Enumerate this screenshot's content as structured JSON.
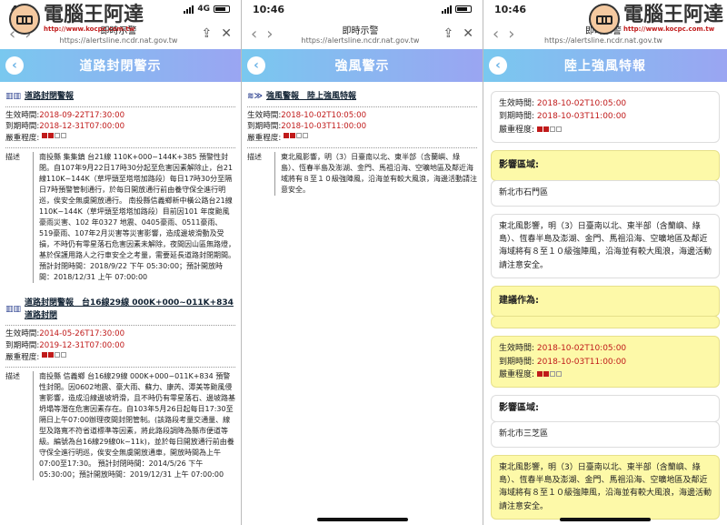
{
  "p1": {
    "time": "46",
    "net": "4G",
    "url_title": "即時示警",
    "url": "https://alertsline.ncdr.nat.gov.tw",
    "header": "道路封閉警示",
    "alerts": [
      {
        "head": "道路封閉警報",
        "effective_label": "生效時間:",
        "effective": "2018-09-22T17:30:00",
        "expire_label": "到期時間:",
        "expire": "2018-12-31T07:00:00",
        "sev_label": "嚴重程度:",
        "desc_label": "描述",
        "desc": "南投縣 集集鎮 台21線 110K+000~144K+385 預警性封閉。自107年9月22日17時30分起至危害因素解除止，台21線110K~144K（草坪頭至塔塔加路段）每日17時30分至隔日7時預警管制通行，於每日開放通行前由養守保全進行明巡，俟安全無虞開放通行。 南投縣信義鄉新中橫公路台21線 110K~144K（草坪頭至塔塔加路段）目前因101 年度颱風豪雨災害、102 年0327 地震、0405豪雨、0511豪雨、519豪雨、107年2月災害等災害影響，造成邊坡滑動及受損，不時仍有零星落石危害因素未解除，夜間因山區無路燈，基於保護用路人之行車安全之考量，需要延長道路封閉期間。 預計封閉時間：2018/9/22 下午 05:30:00；預計開放時間：2018/12/31 上午 07:00:00"
      },
      {
        "head": "道路封閉警報　台16線29線 000K+000~011K+834 道路封閉",
        "effective_label": "生效時間:",
        "effective": "2014-05-26T17:30:00",
        "expire_label": "到期時間:",
        "expire": "2019-12-31T07:00:00",
        "sev_label": "嚴重程度:",
        "desc_label": "描述",
        "desc": "南投縣 信義鄉 台16線29線 000K+000~011K+834 預警性封閉。因0602地震、豪大雨、蘇力、康芮、潭美等颱風侵害影響，造成沿線邊坡坍滑，且不時仍有零星落石、邊坡路基坍塌等潛在危害因素存在。自103年5月26日起每日17:30至隔日上午07:00辦理夜間封閉管制。(該路段考量交通量、線型及路寬不符省道標準等因素，將此路段調降為縣市便道等級。編號為台16線29線0k~11k)，並於每日開放通行前由養守保全進行明巡，俟安全無虞開放通車，開放時間為上午07:00至17:30。 預計封閉時間：2014/5/26 下午 05:30:00；預計開放時間：2019/12/31 上午 07:00:00"
      }
    ]
  },
  "p2": {
    "time": "10:46",
    "url_title": "即時示警",
    "url": "https://alertsline.ncdr.nat.gov.tw",
    "header": "強風警示",
    "head": "強風警報　陸上強風特報",
    "effective_label": "生效時間:",
    "effective": "2018-10-02T10:05:00",
    "expire_label": "到期時間:",
    "expire": "2018-10-03T11:00:00",
    "sev_label": "嚴重程度:",
    "desc_label": "描述",
    "desc": "東北風影響，明（3）日臺南以北、東半部（含蘭嶼、綠島）、恆春半島及澎湖、金門、馬祖沿海、空曠地區及鄰近海域將有８至１０級強陣風，沿海並有較大風浪，海邊活動請注意安全。"
  },
  "p3": {
    "time": "10:46",
    "url_title": "即時示警",
    "url": "https://alertsline.ncdr.nat.gov.tw",
    "header": "陸上強風特報",
    "effective_label": "生效時間:",
    "effective": "2018-10-02T10:05:00",
    "expire_label": "到期時間:",
    "expire": "2018-10-03T11:00:00",
    "sev_label": "嚴重程度:",
    "area_label": "影響區域:",
    "area1": "新北市石門區",
    "desc": "東北風影響，明（3）日臺南以北、東半部（含蘭嶼、綠島）、恆春半島及澎湖、金門、馬祖沿海、空曠地區及鄰近海域將有８至１０級強陣風，沿海並有較大風浪，海邊活動請注意安全。",
    "advice_label": "建議作為:",
    "area2": "新北市三芝區",
    "desc2": "東北風影響，明（3）日臺南以北、東半部（含蘭嶼、綠島）、恆春半島及澎湖、金門、馬祖沿海、空曠地區及鄰近海域將有８至１０級強陣風，沿海並有較大風浪，海邊活動請注意安全。"
  },
  "watermark": {
    "text": "電腦王阿達",
    "url": "http://www.kocpc.com.tw"
  },
  "colors": {
    "accent_red": "#c01a1a",
    "header_start": "#79c8ef",
    "header_end": "#9aa5f2",
    "card_yellow": "#fdf9a8"
  },
  "severity_level": 2,
  "severity_max": 4
}
